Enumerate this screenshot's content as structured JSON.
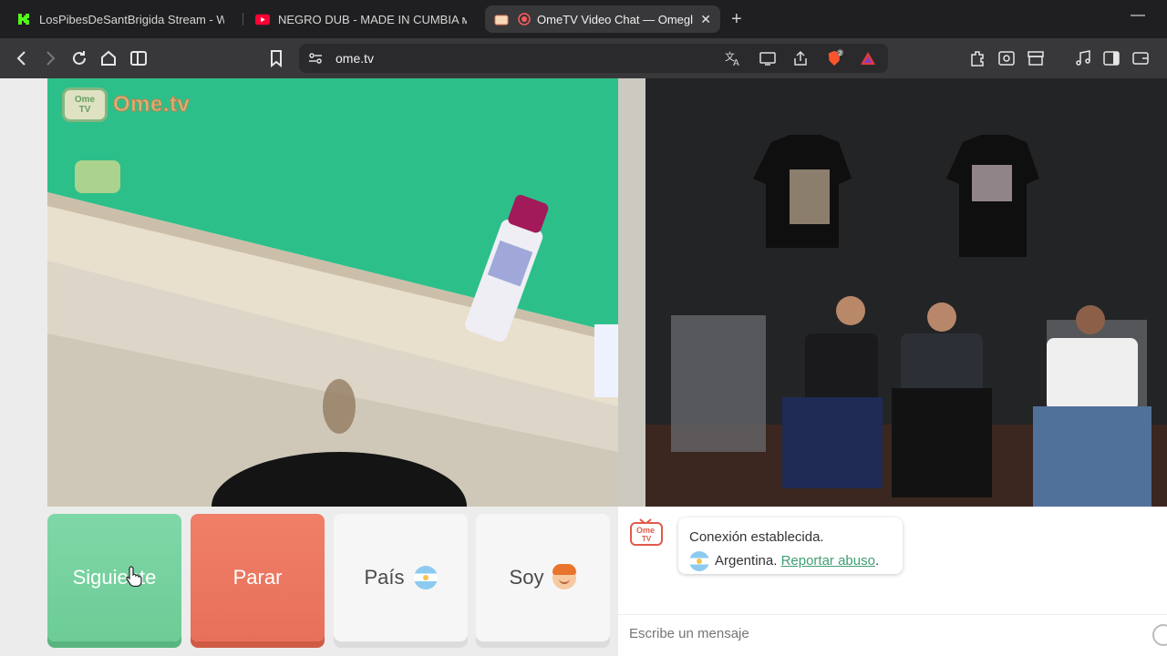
{
  "browser": {
    "tabs": [
      {
        "title": "LosPibesDeSantBrigida Stream - Wat",
        "favicon": "kick-icon",
        "active": false
      },
      {
        "title": "NEGRO DUB - MADE IN CUMBIA ᴍxᴀ",
        "favicon": "youtube-icon",
        "active": false
      },
      {
        "title": "OmeTV Video Chat — Omegl",
        "favicon": "ometv-icon",
        "active": true
      }
    ],
    "close_label": "✕",
    "new_tab_label": "+",
    "minimize_label": "—",
    "url": "ome.tv",
    "brave_shield_count": "2"
  },
  "page": {
    "logo": {
      "tv_line1": "Ome",
      "tv_line2": "TV",
      "brand": "Ome.tv"
    },
    "buttons": {
      "next": "Siguiente",
      "stop": "Parar",
      "country": "País",
      "gender": "Soy"
    },
    "chat": {
      "logo_line1": "Ome",
      "logo_line2": "TV",
      "status": "Conexión establecida.",
      "country": "Argentina.",
      "report": "Reportar abuso",
      "report_suffix": ".",
      "input_placeholder": "Escribe un mensaje"
    }
  },
  "colors": {
    "next": "#6dcc96",
    "stop": "#e8705a",
    "report_link": "#3f9f73"
  }
}
